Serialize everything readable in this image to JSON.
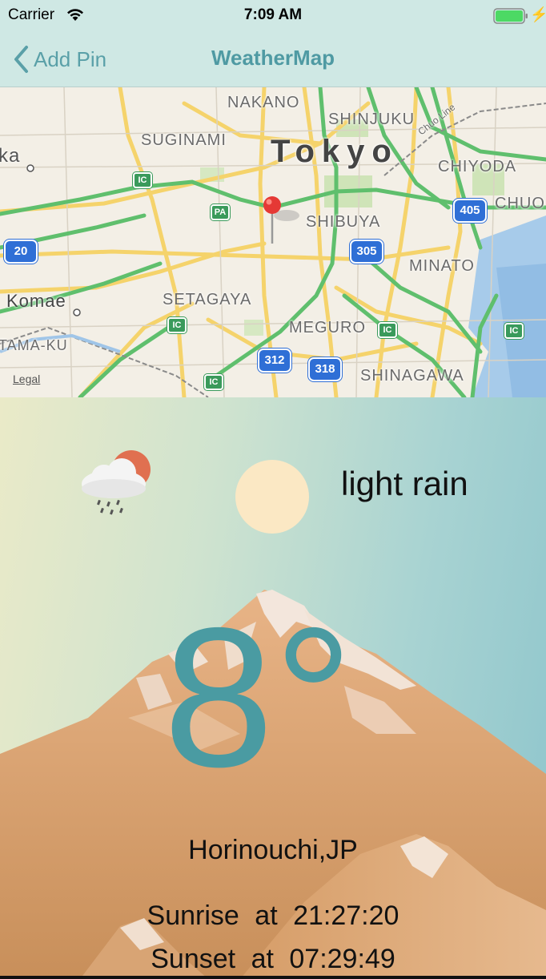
{
  "status_bar": {
    "carrier": "Carrier",
    "time": "7:09 AM",
    "battery_color": "#4cd964"
  },
  "nav": {
    "back_label": "Add Pin",
    "title": "WeatherMap",
    "accent": "#5aa0a8"
  },
  "map": {
    "city": "Tokyo",
    "districts": [
      "NAKANO",
      "SHINJUKU",
      "SUGINAMI",
      "CHIYODA",
      "CHUO",
      "SHIBUYA",
      "MINATO",
      "SETAGAYA",
      "MEGURO",
      "SHINAGAWA",
      "TAMA-KU",
      "Komae",
      "ka"
    ],
    "road_label": "Chuo Line",
    "route_shields": [
      "20",
      "405",
      "305",
      "312",
      "318"
    ],
    "ic_label": "IC",
    "pa_label": "PA",
    "legal": "Legal"
  },
  "weather": {
    "description": "light rain",
    "temperature": "8°",
    "location": "Horinouchi,JP",
    "sunrise_label": "Sunrise",
    "sunrise_at": "at",
    "sunrise_time": "21:27:20",
    "sunset_label": "Sunset",
    "sunset_at": "at",
    "sunset_time": "07:29:49",
    "icon": "cloud-rain-sun-icon",
    "temp_color": "#4a9ba2"
  }
}
